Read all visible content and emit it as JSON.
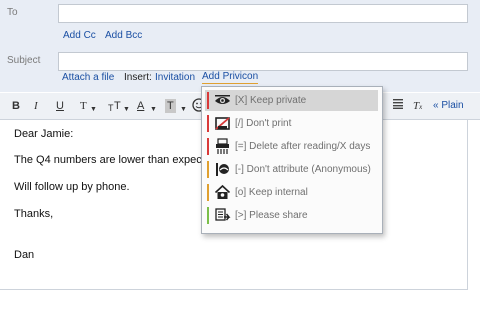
{
  "compose": {
    "to_label": "To",
    "add_cc": "Add Cc",
    "add_bcc": "Add Bcc",
    "subject_label": "Subject",
    "attach_file": "Attach a file",
    "insert_label": "Insert:",
    "invitation": "Invitation",
    "add_privicon": "Add Privicon"
  },
  "toolbar": {
    "bold": "B",
    "italic": "I",
    "underline": "U",
    "font": "T",
    "size": "T",
    "text_color": "A",
    "highlight": "T",
    "clear_format": "T",
    "plain_text": "« Plain"
  },
  "body": {
    "lines": [
      "Dear Jamie:",
      "The Q4 numbers are lower than expected.",
      "Will follow up by phone.",
      "Thanks,",
      "Dan"
    ]
  },
  "privicon_menu": {
    "items": [
      {
        "label": "[X]  Keep private",
        "bar_color": "#d93a3a",
        "icon": "eye-icon"
      },
      {
        "label": "[/]  Don't print",
        "bar_color": "#d93a3a",
        "icon": "no-print-icon"
      },
      {
        "label": "[=]  Delete after reading/X days",
        "bar_color": "#d93a3a",
        "icon": "shredder-icon"
      },
      {
        "label": "[-]  Don't attribute (Anonymous)",
        "bar_color": "#e0a030",
        "icon": "anonymous-icon"
      },
      {
        "label": "[o]  Keep internal",
        "bar_color": "#e0a030",
        "icon": "house-icon"
      },
      {
        "label": "[>]  Please share",
        "bar_color": "#7bbf4a",
        "icon": "share-icon"
      }
    ]
  }
}
